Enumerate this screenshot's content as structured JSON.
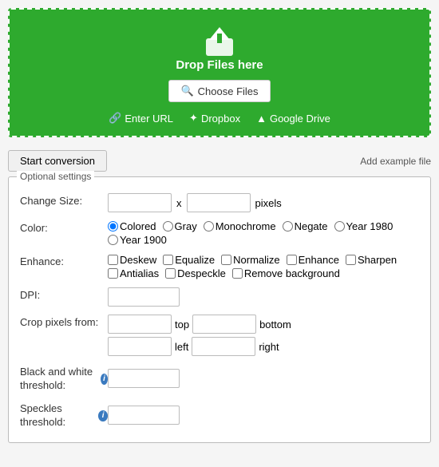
{
  "dropzone": {
    "drop_text": "Drop Files here",
    "choose_btn": "Choose Files",
    "enter_url": "Enter URL",
    "dropbox": "Dropbox",
    "google_drive": "Google Drive"
  },
  "toolbar": {
    "start_btn": "Start conversion",
    "add_example": "Add example file"
  },
  "settings": {
    "legend": "Optional settings",
    "change_size_label": "Change Size:",
    "x_label": "x",
    "pixels_label": "pixels",
    "color_label": "Color:",
    "color_options": [
      "Colored",
      "Gray",
      "Monochrome",
      "Negate",
      "Year 1980",
      "Year 1900"
    ],
    "enhance_label": "Enhance:",
    "enhance_options": [
      "Deskew",
      "Equalize",
      "Normalize",
      "Enhance",
      "Sharpen",
      "Antialias",
      "Despeckle",
      "Remove background"
    ],
    "dpi_label": "DPI:",
    "crop_label": "Crop pixels from:",
    "top_label": "top",
    "bottom_label": "bottom",
    "left_label": "left",
    "right_label": "right",
    "bw_threshold_label": "Black and white threshold:",
    "speckles_label": "Speckles threshold:"
  }
}
